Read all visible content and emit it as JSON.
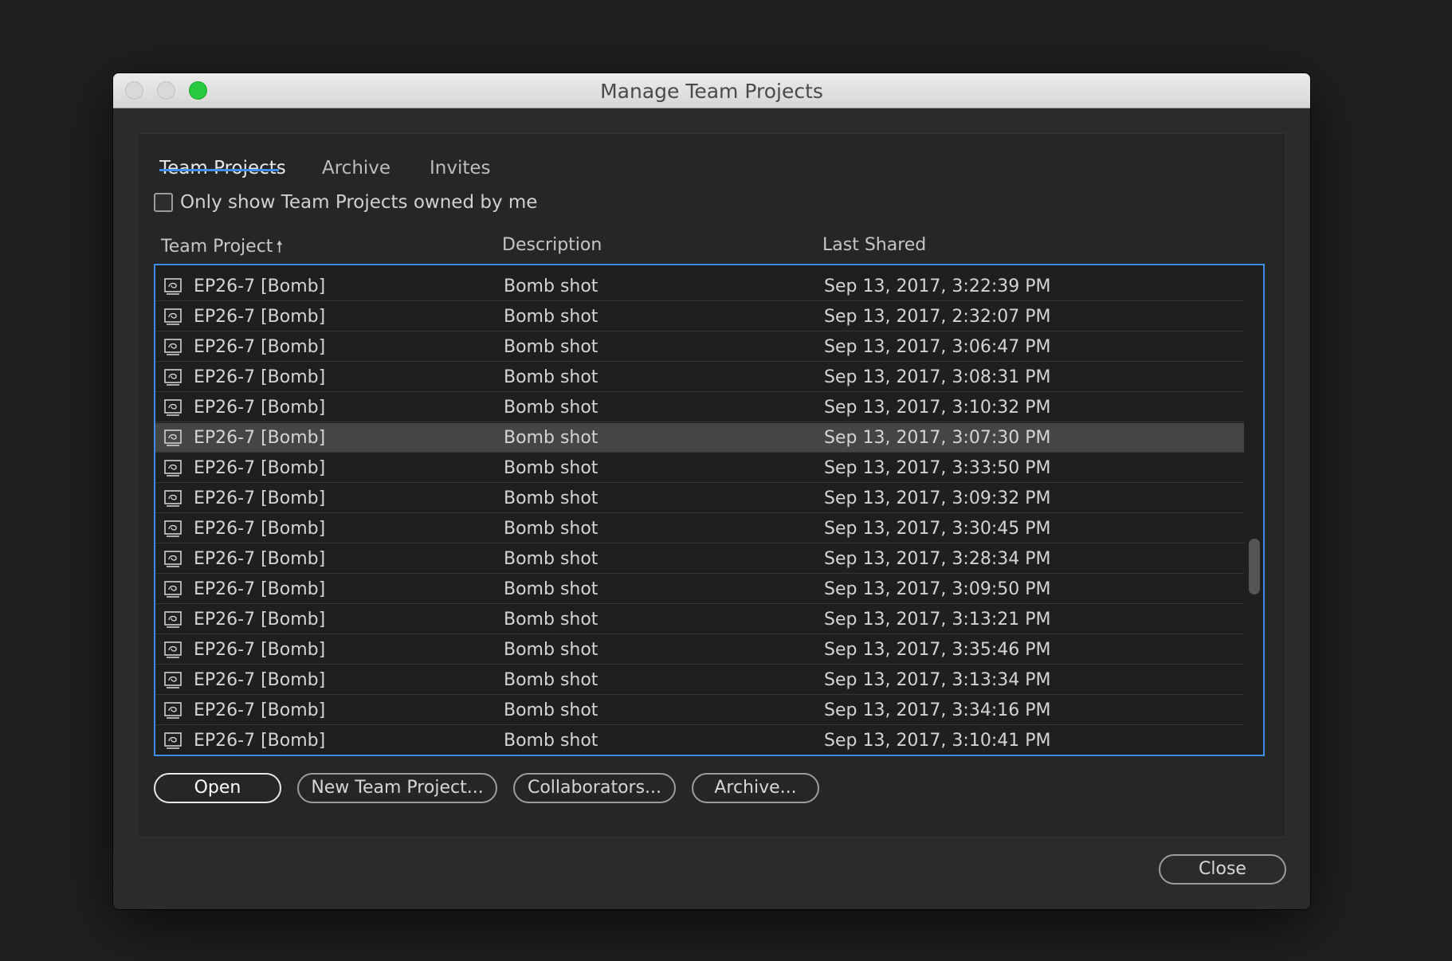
{
  "window": {
    "title": "Manage Team Projects"
  },
  "tabs": [
    {
      "label": "Team Projects",
      "active": true
    },
    {
      "label": "Archive",
      "active": false
    },
    {
      "label": "Invites",
      "active": false
    }
  ],
  "filter": {
    "label": "Only show Team Projects owned by me",
    "checked": false
  },
  "columns": {
    "project": "Team Project",
    "project_sort_indicator": "🠕",
    "description": "Description",
    "last_shared": "Last Shared"
  },
  "rows": [
    {
      "project": "EP26-7 [Bomb]",
      "description": "Bomb shot",
      "last_shared": "Sep 13, 2017, 3:22:39 PM"
    },
    {
      "project": "EP26-7 [Bomb]",
      "description": "Bomb shot",
      "last_shared": "Sep 13, 2017, 2:32:07 PM"
    },
    {
      "project": "EP26-7 [Bomb]",
      "description": "Bomb shot",
      "last_shared": "Sep 13, 2017, 3:06:47 PM"
    },
    {
      "project": "EP26-7 [Bomb]",
      "description": "Bomb shot",
      "last_shared": "Sep 13, 2017, 3:08:31 PM"
    },
    {
      "project": "EP26-7 [Bomb]",
      "description": "Bomb shot",
      "last_shared": "Sep 13, 2017, 3:10:32 PM"
    },
    {
      "project": "EP26-7 [Bomb]",
      "description": "Bomb shot",
      "last_shared": "Sep 13, 2017, 3:07:30 PM",
      "selected": true
    },
    {
      "project": "EP26-7 [Bomb]",
      "description": "Bomb shot",
      "last_shared": "Sep 13, 2017, 3:33:50 PM"
    },
    {
      "project": "EP26-7 [Bomb]",
      "description": "Bomb shot",
      "last_shared": "Sep 13, 2017, 3:09:32 PM"
    },
    {
      "project": "EP26-7 [Bomb]",
      "description": "Bomb shot",
      "last_shared": "Sep 13, 2017, 3:30:45 PM"
    },
    {
      "project": "EP26-7 [Bomb]",
      "description": "Bomb shot",
      "last_shared": "Sep 13, 2017, 3:28:34 PM"
    },
    {
      "project": "EP26-7 [Bomb]",
      "description": "Bomb shot",
      "last_shared": "Sep 13, 2017, 3:09:50 PM"
    },
    {
      "project": "EP26-7 [Bomb]",
      "description": "Bomb shot",
      "last_shared": "Sep 13, 2017, 3:13:21 PM"
    },
    {
      "project": "EP26-7 [Bomb]",
      "description": "Bomb shot",
      "last_shared": "Sep 13, 2017, 3:35:46 PM"
    },
    {
      "project": "EP26-7 [Bomb]",
      "description": "Bomb shot",
      "last_shared": "Sep 13, 2017, 3:13:34 PM"
    },
    {
      "project": "EP26-7 [Bomb]",
      "description": "Bomb shot",
      "last_shared": "Sep 13, 2017, 3:34:16 PM"
    },
    {
      "project": "EP26-7 [Bomb]",
      "description": "Bomb shot",
      "last_shared": "Sep 13, 2017, 3:10:41 PM"
    }
  ],
  "row_icon": "team-project-icon",
  "buttons": {
    "open": "Open",
    "new_team_project": "New Team Project...",
    "collaborators": "Collaborators...",
    "archive": "Archive...",
    "close": "Close"
  },
  "colors": {
    "accent": "#3d8ee8",
    "selected_row": "#454545",
    "background": "#2b2b2b",
    "zoom_button": "#27c93f"
  }
}
